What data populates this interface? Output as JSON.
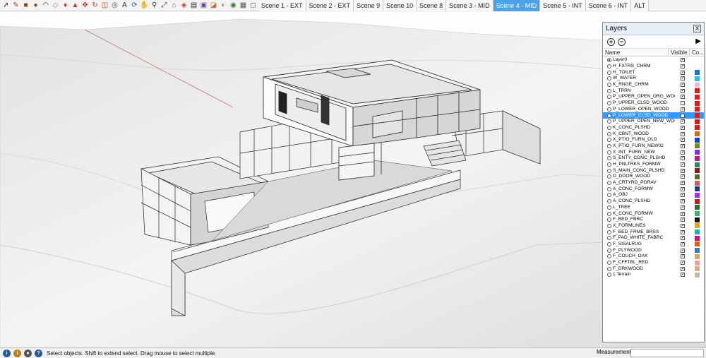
{
  "toolbar": {
    "tools": [
      {
        "icon": "select-arrow-icon",
        "glyph": "➚",
        "color": "#222222"
      },
      {
        "icon": "pencil-line-icon",
        "glyph": "✎",
        "color": "#b03020"
      },
      {
        "icon": "rectangle-icon",
        "glyph": "■",
        "color": "#8b4513"
      },
      {
        "icon": "circle-icon",
        "glyph": "●",
        "color": "#8b4513"
      },
      {
        "icon": "arc-icon",
        "glyph": "◠",
        "color": "#333333"
      },
      {
        "icon": "eraser-icon",
        "glyph": "◇",
        "color": "#c060a0"
      },
      {
        "icon": "paint-bucket-icon",
        "glyph": "♦",
        "color": "#c0392b"
      },
      {
        "icon": "push-pull-icon",
        "glyph": "▲",
        "color": "#c0392b"
      },
      {
        "icon": "move-icon",
        "glyph": "✥",
        "color": "#c0392b"
      },
      {
        "icon": "rotate-icon",
        "glyph": "↻",
        "color": "#c0392b"
      },
      {
        "icon": "offset-icon",
        "glyph": "◫",
        "color": "#c0392b"
      },
      {
        "icon": "tape-measure-icon",
        "glyph": "◎",
        "color": "#555555"
      },
      {
        "icon": "text-icon",
        "glyph": "A",
        "color": "#333333"
      },
      {
        "icon": "orbit-icon",
        "glyph": "⟳",
        "color": "#2060c0"
      },
      {
        "icon": "pan-icon",
        "glyph": "✋",
        "color": "#b07030"
      },
      {
        "icon": "zoom-icon",
        "glyph": "⚲",
        "color": "#333333"
      },
      {
        "icon": "zoom-extents-icon",
        "glyph": "⤢",
        "color": "#333333"
      },
      {
        "icon": "warehouse-icon",
        "glyph": "⌂",
        "color": "#8b5a2b"
      },
      {
        "icon": "extension-icon",
        "glyph": "◈",
        "color": "#c0392b"
      },
      {
        "icon": "model-info-icon",
        "glyph": "▤",
        "color": "#333333"
      },
      {
        "icon": "styles-icon",
        "glyph": "▣",
        "color": "#6a4a8a"
      },
      {
        "icon": "section-plane-icon",
        "glyph": "◪",
        "color": "#c07030"
      },
      {
        "icon": "shadows-icon",
        "glyph": "◐",
        "color": "#c08020"
      },
      {
        "icon": "fog-icon",
        "glyph": "◉",
        "color": "#2d7a2d"
      },
      {
        "icon": "xray-icon",
        "glyph": "▦",
        "color": "#555555"
      },
      {
        "icon": "face-style-icon",
        "glyph": "◻",
        "color": "#555555"
      }
    ],
    "scenes": [
      {
        "label": "Scene 1 - EXT",
        "active": false
      },
      {
        "label": "Scene 2 - EXT",
        "active": false
      },
      {
        "label": "Scene 9",
        "active": false
      },
      {
        "label": "Scene 10",
        "active": false
      },
      {
        "label": "Scene 8",
        "active": false
      },
      {
        "label": "Scene 3 - MID",
        "active": false
      },
      {
        "label": "Scene 4 - MID",
        "active": true
      },
      {
        "label": "Scene 5 - INT",
        "active": false
      },
      {
        "label": "Scene 6 - INT",
        "active": false
      },
      {
        "label": "ALT",
        "active": false
      }
    ]
  },
  "layers_panel": {
    "title": "Layers",
    "close_glyph": "X",
    "add_glyph": "+",
    "remove_glyph": "−",
    "details_glyph": "▶",
    "columns": {
      "name": "Name",
      "visible": "Visible",
      "color": "Co..."
    },
    "layers": [
      {
        "name": "Layer0",
        "visible": true,
        "color": "",
        "active": true,
        "selected": false
      },
      {
        "name": "H_FXTRS_CHRM",
        "visible": true,
        "color": "#ffffff",
        "active": false,
        "selected": false
      },
      {
        "name": "H_TOILET",
        "visible": true,
        "color": "#1f6fcf",
        "active": false,
        "selected": false
      },
      {
        "name": "W_WATER",
        "visible": true,
        "color": "#27c0e0",
        "active": false,
        "selected": false
      },
      {
        "name": "K_RNGE_CHRM",
        "visible": true,
        "color": "#f4b8d8",
        "active": false,
        "selected": false
      },
      {
        "name": "L_TRRN",
        "visible": true,
        "color": "#e01a1a",
        "active": false,
        "selected": false
      },
      {
        "name": "P_UPPER_OPEN_ORG_WOOD",
        "visible": true,
        "color": "#e01a1a",
        "active": false,
        "selected": false
      },
      {
        "name": "P_UPPER_CLSD_WOOD",
        "visible": false,
        "color": "#e01a1a",
        "active": false,
        "selected": false
      },
      {
        "name": "P_LOWER_OPEN_WOOD",
        "visible": true,
        "color": "#e01a1a",
        "active": false,
        "selected": false
      },
      {
        "name": "P_LOWER_CLSD_WOOD",
        "visible": false,
        "color": "#e01a1a",
        "active": false,
        "selected": true
      },
      {
        "name": "P_UPPER_OPEN_NEW_WOOD",
        "visible": true,
        "color": "#e01a1a",
        "active": false,
        "selected": false
      },
      {
        "name": "K_CONC_PLSHD",
        "visible": true,
        "color": "#e01a1a",
        "active": false,
        "selected": false
      },
      {
        "name": "K_CBNT_WOOD",
        "visible": true,
        "color": "#d2691e",
        "active": false,
        "selected": false
      },
      {
        "name": "X_PTIO_FURN_OLD",
        "visible": true,
        "color": "#1a3fbf",
        "active": false,
        "selected": false
      },
      {
        "name": "X_PTIO_FURN_NEW02",
        "visible": true,
        "color": "#6b8e23",
        "active": false,
        "selected": false
      },
      {
        "name": "X_INT_FURN_NEW",
        "visible": true,
        "color": "#8a2be2",
        "active": false,
        "selected": false
      },
      {
        "name": "S_ENTY_CONC_PLSHD",
        "visible": true,
        "color": "#c71585",
        "active": false,
        "selected": false
      },
      {
        "name": "H_PNLTRKS_FORMW",
        "visible": true,
        "color": "#2e8b57",
        "active": false,
        "selected": false
      },
      {
        "name": "S_MAIN_CONC_PLSHD",
        "visible": true,
        "color": "#8b1a1a",
        "active": false,
        "selected": false
      },
      {
        "name": "D_DOOR_WOOD",
        "visible": true,
        "color": "#556b2f",
        "active": false,
        "selected": false
      },
      {
        "name": "A_CRTYRD_PGRAV",
        "visible": true,
        "color": "#cd5c5c",
        "active": false,
        "selected": false
      },
      {
        "name": "A_CONC_FORMW",
        "visible": true,
        "color": "#1e3a8a",
        "active": false,
        "selected": false
      },
      {
        "name": "A_OBJ",
        "visible": true,
        "color": "#9b30ff",
        "active": false,
        "selected": false
      },
      {
        "name": "A_CONC_PLSHD",
        "visible": true,
        "color": "#b22222",
        "active": false,
        "selected": false
      },
      {
        "name": "L_TREE",
        "visible": true,
        "color": "#2f6f2f",
        "active": false,
        "selected": false
      },
      {
        "name": "K_CONC_FORMW",
        "visible": true,
        "color": "#3cb371",
        "active": false,
        "selected": false
      },
      {
        "name": "F_BED_FBRC",
        "visible": true,
        "color": "#111111",
        "active": false,
        "selected": false
      },
      {
        "name": "X_FORMLINES",
        "visible": true,
        "color": "#daa520",
        "active": false,
        "selected": false
      },
      {
        "name": "F_BED_FRME_BRSS",
        "visible": true,
        "color": "#20b2aa",
        "active": false,
        "selected": false
      },
      {
        "name": "F_PAD_WHITE_FABRC",
        "visible": true,
        "color": "#c71585",
        "active": false,
        "selected": false
      },
      {
        "name": "F_SISALRUG",
        "visible": true,
        "color": "#e05a10",
        "active": false,
        "selected": false
      },
      {
        "name": "F_PLYWOOD",
        "visible": true,
        "color": "#3a7ab5",
        "active": false,
        "selected": false
      },
      {
        "name": "F_COUCH_OAK",
        "visible": true,
        "color": "#c9a86a",
        "active": false,
        "selected": false
      },
      {
        "name": "F_CFFTBL_RED",
        "visible": true,
        "color": "#f0a0a0",
        "active": false,
        "selected": false
      },
      {
        "name": "F_DRKWOOD",
        "visible": true,
        "color": "#d2b48c",
        "active": false,
        "selected": false
      },
      {
        "name": "1 Terrain",
        "visible": true,
        "color": "#c0b8a0",
        "active": false,
        "selected": false
      }
    ]
  },
  "statusbar": {
    "icons": [
      {
        "icon": "geo-location-icon",
        "glyph": "i",
        "color": "#2a5a9a"
      },
      {
        "icon": "credits-icon",
        "glyph": "i",
        "color": "#c08010"
      },
      {
        "icon": "user-icon",
        "glyph": "●",
        "color": "#555555"
      },
      {
        "icon": "help-icon",
        "glyph": "?",
        "color": "#2a5a9a"
      }
    ],
    "message": "Select objects. Shift to extend select. Drag mouse to select multiple.",
    "measurements_label": "Measurements"
  }
}
